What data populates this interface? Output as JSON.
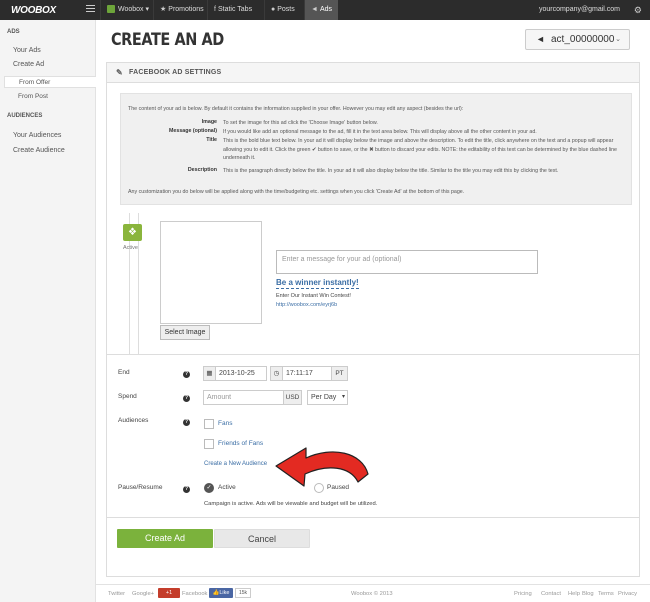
{
  "topbar": {
    "logo": "WOOBOX",
    "app_menu": "Woobox",
    "nav": [
      "Promotions",
      "Static Tabs",
      "Posts",
      "Ads"
    ],
    "email": "yourcompany@gmail.com"
  },
  "sidebar": {
    "section_ads": "ADS",
    "your_ads": "Your Ads",
    "create_ad": "Create Ad",
    "from_offer": "From Offer",
    "from_post": "From Post",
    "section_audiences": "AUDIENCES",
    "your_audiences": "Your Audiences",
    "create_audience": "Create Audience"
  },
  "page": {
    "title": "CREATE AN AD",
    "account": "act_00000000"
  },
  "panel": {
    "heading": "FACEBOOK AD SETTINGS",
    "info": {
      "intro": "The content of your ad is below. By default it contains the information supplied in your offer. However you may edit any aspect (besides the url):",
      "rows": [
        {
          "label": "Image",
          "text": "To set the image for this ad click the 'Choose Image' button below."
        },
        {
          "label": "Message (optional)",
          "text": "If you would like add an optional message to the ad, fill it in the text area below. This will display above all the other content in your ad."
        },
        {
          "label": "Title",
          "text": "This is the bold blue text below. In your ad it will display below the image and above the description. To edit the title, click anywhere on the text and a popup will appear allowing you to edit it. Click the green ✔ button to save, or the ✖ button to discard your edits. NOTE: the editability of this text can be determined by the blue dashed line underneath it."
        },
        {
          "label": "Description",
          "text": "This is the paragraph directly below the title. In your ad it will also display below the title. Similar to the title you may edit this by clicking the text."
        }
      ],
      "outro": "Any customization you do below will be applied along with the time/budgeting etc. settings when you click 'Create Ad' at the bottom of this page."
    },
    "ad": {
      "status": "Active",
      "select_image": "Select Image",
      "message_placeholder": "Enter a message for your ad (optional)",
      "title": "Be a winner instantly!",
      "description": "Enter Our Instant Win Contest!",
      "url": "http://woobox.com/eyrj6b"
    },
    "form": {
      "end_label": "End",
      "end_date": "2013-10-25",
      "end_time": "17:11:17",
      "timezone": "PT",
      "spend_label": "Spend",
      "amount_placeholder": "Amount",
      "currency": "USD",
      "period": "Per Day",
      "audiences_label": "Audiences",
      "fans": "Fans",
      "friends_of_fans": "Friends of Fans",
      "create_new_audience": "Create a New Audience",
      "pause_label": "Pause/Resume",
      "active": "Active",
      "paused": "Paused",
      "campaign_note": "Campaign is active. Ads will be viewable and budget will be utilized."
    },
    "buttons": {
      "create": "Create Ad",
      "cancel": "Cancel"
    }
  },
  "footer": {
    "twitter": "Twitter",
    "googleplus": "Google+",
    "gplus_btn": "+1",
    "facebook": "Facebook",
    "like": "Like",
    "like_count": "15k",
    "copyright": "Woobox © 2013",
    "links": [
      "Pricing",
      "Contact",
      "Help",
      "Blog",
      "Terms",
      "Privacy"
    ]
  },
  "colors": {
    "accent_green": "#7bb23c",
    "link_blue": "#3b6ea5",
    "arrow_red": "#e32a22",
    "topbar": "#2c2c2c"
  }
}
